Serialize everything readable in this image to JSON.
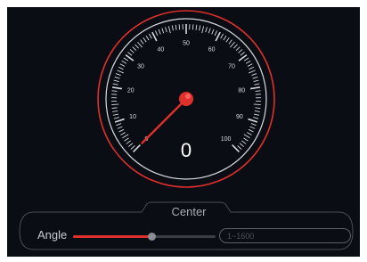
{
  "gauge": {
    "value": "0",
    "min": 0,
    "max": 100,
    "labels": [
      "0",
      "10",
      "20",
      "30",
      "40",
      "50",
      "60",
      "70",
      "80",
      "90",
      "100"
    ],
    "accent_color": "#e0302c",
    "needle_color": "#e0302c",
    "dial_color": "#d8dbe0"
  },
  "panel": {
    "title": "Center",
    "slider_label": "Angle",
    "slider_level": 0.55,
    "range_placeholder": "1~1600"
  }
}
